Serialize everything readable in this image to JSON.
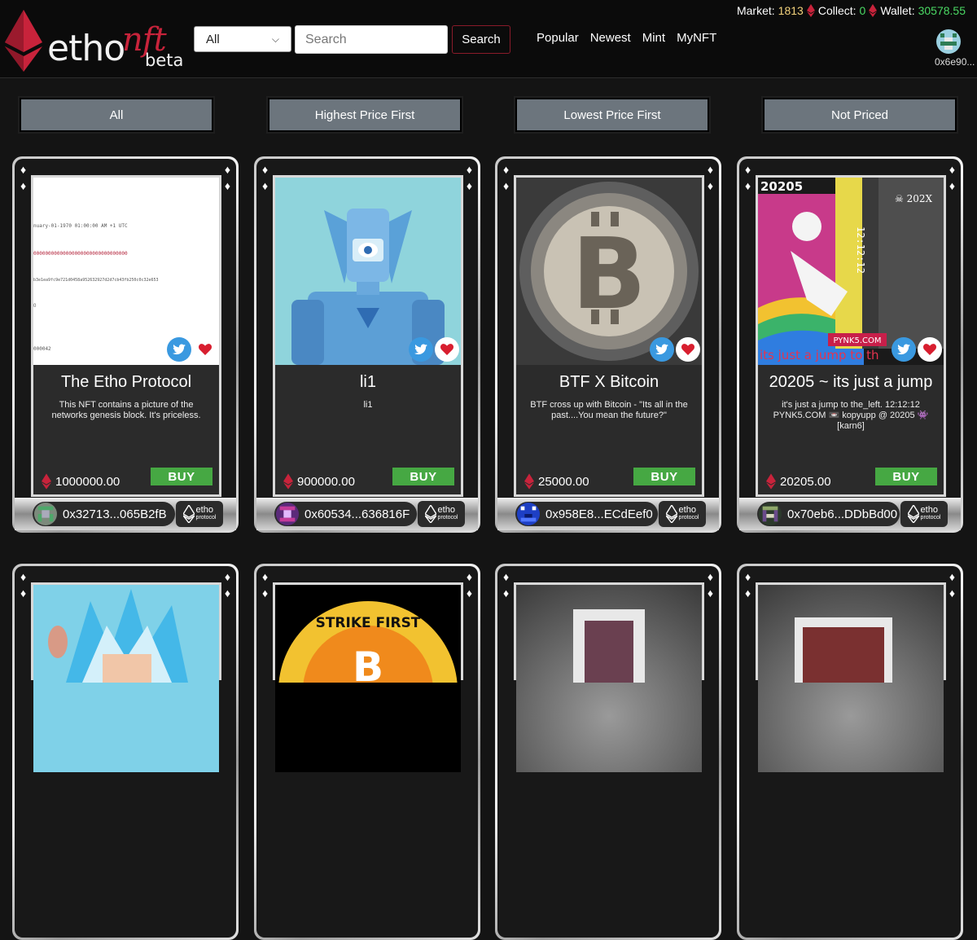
{
  "brand": {
    "name": "etho",
    "suffix": "nft",
    "tag": "beta",
    "accent": "#c8233b"
  },
  "filter": {
    "selected": "All"
  },
  "search": {
    "placeholder": "Search",
    "button": "Search"
  },
  "nav": [
    "Popular",
    "Newest",
    "Mint",
    "MyNFT"
  ],
  "stats": {
    "market_label": "Market:",
    "market_value": "1813",
    "collect_label": "Collect:",
    "collect_value": "0",
    "wallet_label": "Wallet:",
    "wallet_value": "30578.55"
  },
  "account": {
    "address": "0x6e90..."
  },
  "sort": [
    "All",
    "Highest Price First",
    "Lowest Price First",
    "Not Priced"
  ],
  "cards": [
    {
      "title": "The Etho Protocol",
      "description": "This NFT contains a picture of the networks genesis block. It's priceless.",
      "price": "1000000.00",
      "buy": "BUY",
      "owner": "0x32713...065B2fB",
      "art": "genesis-block-screenshot",
      "art_lines": [
        "nuary-01-1970 01:00:00 AM +1 UTC",
        "00000000000000000000000000000000",
        "b3e1ea9fc9e721d0458a952632927d2d7cb43fb250c0c32e653",
        "0",
        "000042"
      ]
    },
    {
      "title": "li1",
      "description": "li1",
      "price": "900000.00",
      "buy": "BUY",
      "owner": "0x60534...636816F",
      "art": "blue-robot"
    },
    {
      "title": "BTF X Bitcoin",
      "description": "BTF cross up with Bitcoin - \"Its all in the past....You mean the future?\"",
      "price": "25000.00",
      "buy": "BUY",
      "owner": "0x958E8...ECdEef0",
      "art": "bitcoin-coin"
    },
    {
      "title": "20205 ~ its just a jump",
      "description": "it's just a jump to the_left. 12:12:12 PYNK5.COM 📼 kopyupp @ 20205 👾 [karn6]",
      "price": "20205.00",
      "buy": "BUY",
      "owner": "0x70eb6...DDbBd00",
      "art": "psychedelic-jump",
      "art_lines": [
        "20205",
        "☠ 202X",
        "12:12:12",
        "PYNK5.COM",
        "its just a jump to th"
      ]
    }
  ],
  "protocol_badge": {
    "line1": "etho",
    "line2": "protocol"
  },
  "bottom_art": {
    "strike": "STRIKE FIRST"
  },
  "colors": {
    "buy": "#46a843",
    "market": "#f3d27c",
    "collect": "#4bd964",
    "twitter": "#3a99e0",
    "heart": "#d81e2f"
  }
}
